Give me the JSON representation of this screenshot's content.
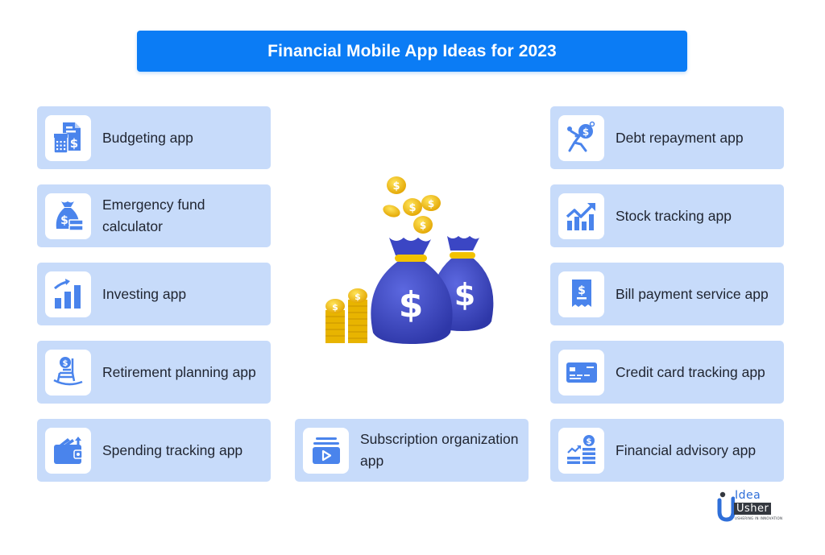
{
  "title": "Financial Mobile App Ideas for 2023",
  "colors": {
    "title_bar": "#0B7CF5",
    "card_bg": "#C7DBFA",
    "icon_blue": "#4A84EC",
    "text": "#1F2430",
    "coin_gold": "#F5C518",
    "bag_blue": "#3B46C4"
  },
  "left_column": [
    {
      "label": "Budgeting app",
      "icon": "budget-calculator-icon"
    },
    {
      "label": "Emergency fund calculator",
      "icon": "money-bag-icon"
    },
    {
      "label": "Investing app",
      "icon": "growth-bar-chart-icon"
    },
    {
      "label": "Retirement planning app",
      "icon": "rocking-chair-icon"
    },
    {
      "label": "Spending tracking app",
      "icon": "wallet-icon"
    }
  ],
  "middle_column": [
    {
      "label": "Subscription organization app",
      "icon": "subscription-play-icon"
    }
  ],
  "right_column": [
    {
      "label": "Debt repayment app",
      "icon": "debt-burden-icon"
    },
    {
      "label": "Stock tracking app",
      "icon": "stock-chart-icon"
    },
    {
      "label": "Bill payment service app",
      "icon": "receipt-icon"
    },
    {
      "label": "Credit card tracking app",
      "icon": "credit-card-icon"
    },
    {
      "label": "Financial advisory app",
      "icon": "coin-stack-trend-icon"
    }
  ],
  "hero": {
    "icon": "money-bags-illustration"
  },
  "logo": {
    "line1": "Idea",
    "line2": "Usher",
    "tagline": "USHERING IN INNOVATION"
  }
}
